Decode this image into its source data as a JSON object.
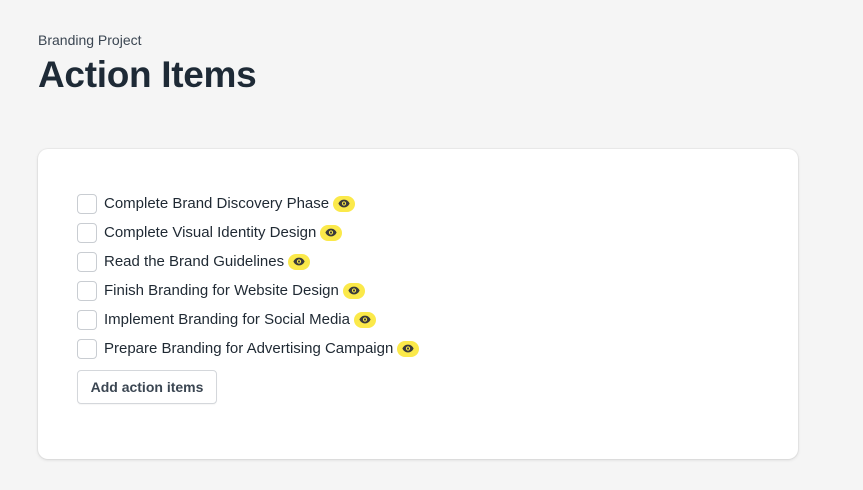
{
  "header": {
    "breadcrumb": "Branding Project",
    "title": "Action Items"
  },
  "action_items": [
    {
      "label": "Complete Brand Discovery Phase",
      "checked": false,
      "icon": "eye-icon"
    },
    {
      "label": "Complete Visual Identity Design",
      "checked": false,
      "icon": "eye-icon"
    },
    {
      "label": "Read the Brand Guidelines",
      "checked": false,
      "icon": "eye-icon"
    },
    {
      "label": "Finish Branding for Website Design",
      "checked": false,
      "icon": "eye-icon"
    },
    {
      "label": "Implement Branding for Social Media",
      "checked": false,
      "icon": "eye-icon"
    },
    {
      "label": "Prepare Branding for Advertising Campaign",
      "checked": false,
      "icon": "eye-icon"
    }
  ],
  "add_button_label": "Add action items",
  "colors": {
    "background": "#f5f5f5",
    "card": "#ffffff",
    "badge": "#fbe94a",
    "text": "#1f2933"
  }
}
